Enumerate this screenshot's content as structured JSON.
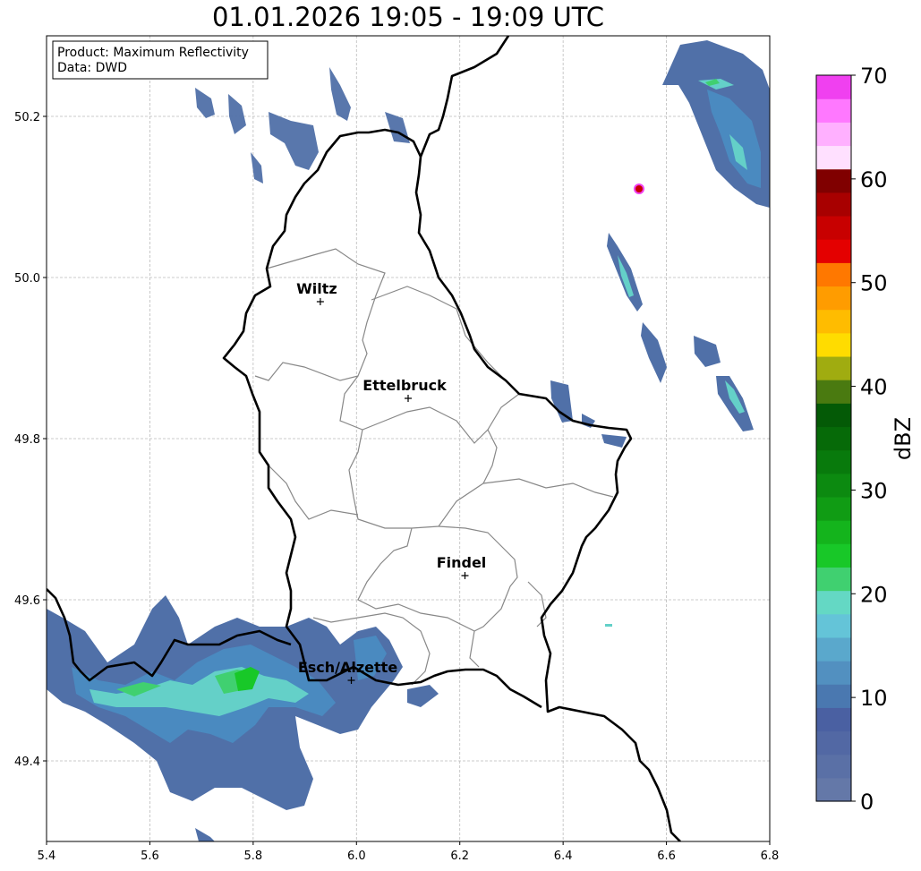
{
  "title": "01.01.2026 19:05 - 19:09 UTC",
  "info_box": {
    "line1": "Product: Maximum Reflectivity",
    "line2": "Data: DWD"
  },
  "map": {
    "lon_range": [
      5.4,
      6.8
    ],
    "lat_range": [
      49.3,
      50.3
    ],
    "x_ticks": [
      "5.4",
      "5.6",
      "5.8",
      "6.0",
      "6.2",
      "6.4",
      "6.6",
      "6.8"
    ],
    "x_tick_values": [
      5.4,
      5.6,
      5.8,
      6.0,
      6.2,
      6.4,
      6.6,
      6.8
    ],
    "y_ticks": [
      "49.4",
      "49.6",
      "49.8",
      "50.0",
      "50.2"
    ],
    "y_tick_values": [
      49.4,
      49.6,
      49.8,
      50.0,
      50.2
    ],
    "grid": true
  },
  "cities": [
    {
      "name": "Wiltz",
      "lon": 5.93,
      "lat": 49.97
    },
    {
      "name": "Ettelbruck",
      "lon": 6.1,
      "lat": 49.85
    },
    {
      "name": "Findel",
      "lon": 6.21,
      "lat": 49.63
    },
    {
      "name": "Esch/Alzette",
      "lon": 5.99,
      "lat": 49.5
    }
  ],
  "colorbar": {
    "label": "dBZ",
    "ticks": [
      "0",
      "10",
      "20",
      "30",
      "40",
      "50",
      "60",
      "70"
    ],
    "tick_values": [
      0,
      10,
      20,
      30,
      40,
      50,
      60,
      70
    ],
    "range": [
      0,
      70
    ],
    "step": 2.5,
    "colors": [
      "#6478a8",
      "#5a70a6",
      "#5268a4",
      "#4a60a2",
      "#4a78b0",
      "#5290c0",
      "#5aa8cc",
      "#64c4d8",
      "#64d8c4",
      "#40d070",
      "#18c828",
      "#14b41c",
      "#109c14",
      "#0c8a10",
      "#087a0c",
      "#066a08",
      "#045a06",
      "#4a7a10",
      "#a0ac10",
      "#ffdc00",
      "#ffbc00",
      "#ff9c00",
      "#ff7800",
      "#e40000",
      "#c80000",
      "#a80000",
      "#800000",
      "#ffe0ff",
      "#ffb0ff",
      "#ff78ff",
      "#f040f0"
    ]
  },
  "echo_colors": {
    "light": "#5070a8",
    "mid": "#4a8ac0",
    "cyan": "#64d0c8",
    "green": "#40d070",
    "core": "#18c828",
    "hot": "#e40000",
    "pink": "#f040f0"
  }
}
